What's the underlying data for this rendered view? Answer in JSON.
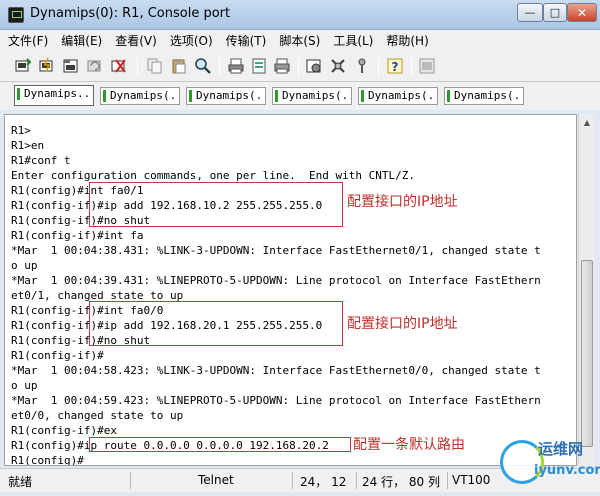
{
  "window": {
    "title": "Dynamips(0): R1, Console port",
    "min_label": "—",
    "max_label": "□",
    "close_label": "✕"
  },
  "menu": [
    "文件(F)",
    "编辑(E)",
    "查看(V)",
    "选项(O)",
    "传输(T)",
    "脚本(S)",
    "工具(L)",
    "帮助(H)"
  ],
  "toolbar": {
    "icons": [
      "connect-icon",
      "quick-connect-icon",
      "connect-tab-icon",
      "reconnect-icon",
      "disconnect-icon",
      "copy-icon",
      "paste-icon",
      "find-icon",
      "print-icon",
      "print-selection-icon",
      "print-screen-icon",
      "session-options-icon",
      "global-options-icon",
      "keymap-icon",
      "help-icon",
      "sftp-icon"
    ]
  },
  "tabs": [
    "Dynamips...",
    "Dynamips(...",
    "Dynamips(...",
    "Dynamips(...",
    "Dynamips(...",
    "Dynamips(..."
  ],
  "terminal": {
    "lines": [
      "R1>",
      "R1>en",
      "R1#conf t",
      "Enter configuration commands, one per line.  End with CNTL/Z.",
      "R1(config)#int fa0/1",
      "R1(config-if)#ip add 192.168.10.2 255.255.255.0",
      "R1(config-if)#no shut",
      "R1(config-if)#int fa",
      "*Mar  1 00:04:38.431: %LINK-3-UPDOWN: Interface FastEthernet0/1, changed state t",
      "o up",
      "*Mar  1 00:04:39.431: %LINEPROTO-5-UPDOWN: Line protocol on Interface FastEthern",
      "et0/1, changed state to up",
      "R1(config-if)#int fa0/0",
      "R1(config-if)#ip add 192.168.20.1 255.255.255.0",
      "R1(config-if)#no shut",
      "R1(config-if)#",
      "*Mar  1 00:04:58.423: %LINK-3-UPDOWN: Interface FastEthernet0/0, changed state t",
      "o up",
      "*Mar  1 00:04:59.423: %LINEPROTO-5-UPDOWN: Line protocol on Interface FastEthern",
      "et0/0, changed state to up",
      "R1(config-if)#ex",
      "R1(config)#ip route 0.0.0.0 0.0.0.0 192.168.20.2",
      "R1(config)#"
    ]
  },
  "annotations": {
    "first": "配置接口的IP地址",
    "second": "配置接口的IP地址",
    "third": "配置一条默认路由"
  },
  "status": {
    "state": "就绪",
    "protocol": "Telnet",
    "cursor": "24， 12",
    "size": "24 行， 80 列",
    "emulation": "VT100"
  },
  "watermark": {
    "cn": "运维网",
    "en": "iyunv.com"
  },
  "colors": {
    "annotation": "#c0302b",
    "tab_marker": "#2c9a2c"
  }
}
